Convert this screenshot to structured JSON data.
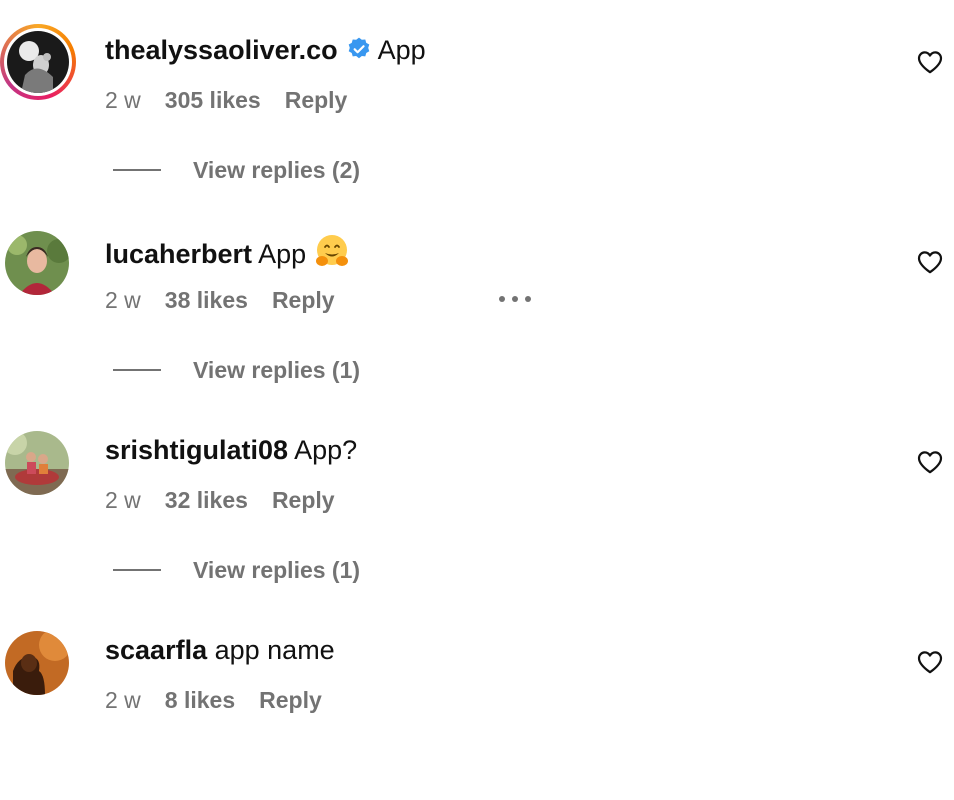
{
  "comments": [
    {
      "username": "thealyssaoliver.co",
      "verified": true,
      "text": "App",
      "time": "2 w",
      "likes": "305 likes",
      "reply_label": "Reply",
      "view_replies": "View replies (2)",
      "has_story_ring": true
    },
    {
      "username": "lucaherbert",
      "verified": false,
      "text": "App",
      "emoji": "hugging-face-emoji",
      "time": "2 w",
      "likes": "38 likes",
      "reply_label": "Reply",
      "has_more_options": true,
      "view_replies": "View replies (1)"
    },
    {
      "username": "srishtigulati08",
      "verified": false,
      "text": "App?",
      "time": "2 w",
      "likes": "32 likes",
      "reply_label": "Reply",
      "view_replies": "View replies (1)"
    },
    {
      "username": "scaarfla",
      "verified": false,
      "text": "app name",
      "time": "2 w",
      "likes": "8 likes",
      "reply_label": "Reply"
    }
  ],
  "icons": {
    "verified": "verified-badge-icon",
    "like": "heart-icon",
    "more": "more-options-icon"
  },
  "colors": {
    "verified_blue": "#3897f0",
    "meta_gray": "#737373",
    "text": "#111111"
  }
}
